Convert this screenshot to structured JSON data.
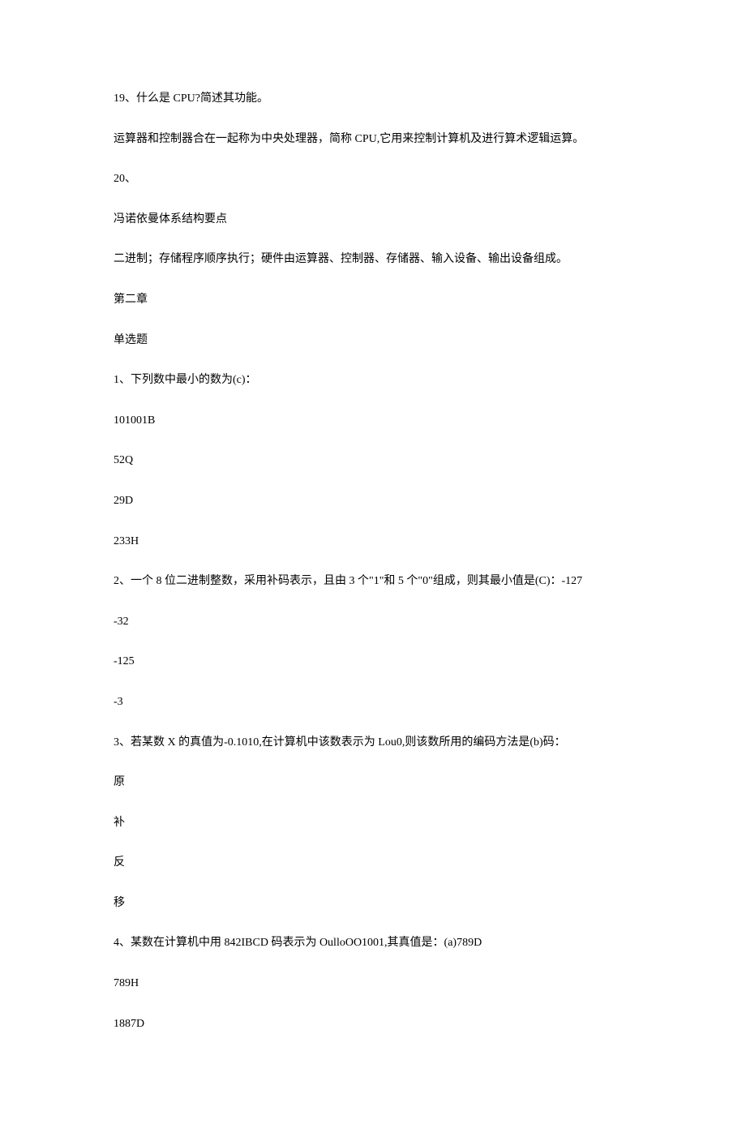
{
  "paragraphs": [
    "19、什么是 CPU?简述其功能。",
    "运算器和控制器合在一起称为中央处理器，简称 CPU,它用来控制计算机及进行算术逻辑运算。",
    "20、",
    "冯诺依曼体系结构要点",
    "二进制；存储程序顺序执行；硬件由运算器、控制器、存储器、输入设备、输出设备组成。",
    "第二章",
    "单选题",
    "1、下列数中最小的数为(c)：",
    "101001B",
    "52Q",
    "29D",
    "233H",
    "2、一个 8 位二进制整数，采用补码表示，且由 3 个\"1\"和 5 个\"0\"组成，则其最小值是(C)：-127",
    "-32",
    "-125",
    "-3",
    "3、若某数 X 的真值为-0.1010,在计算机中该数表示为 Lou0,则该数所用的编码方法是(b)码：",
    "原",
    "补",
    "反",
    "移",
    "4、某数在计算机中用 842IBCD 码表示为 OulloOO1001,其真值是：(a)789D",
    "789H",
    "1887D"
  ]
}
